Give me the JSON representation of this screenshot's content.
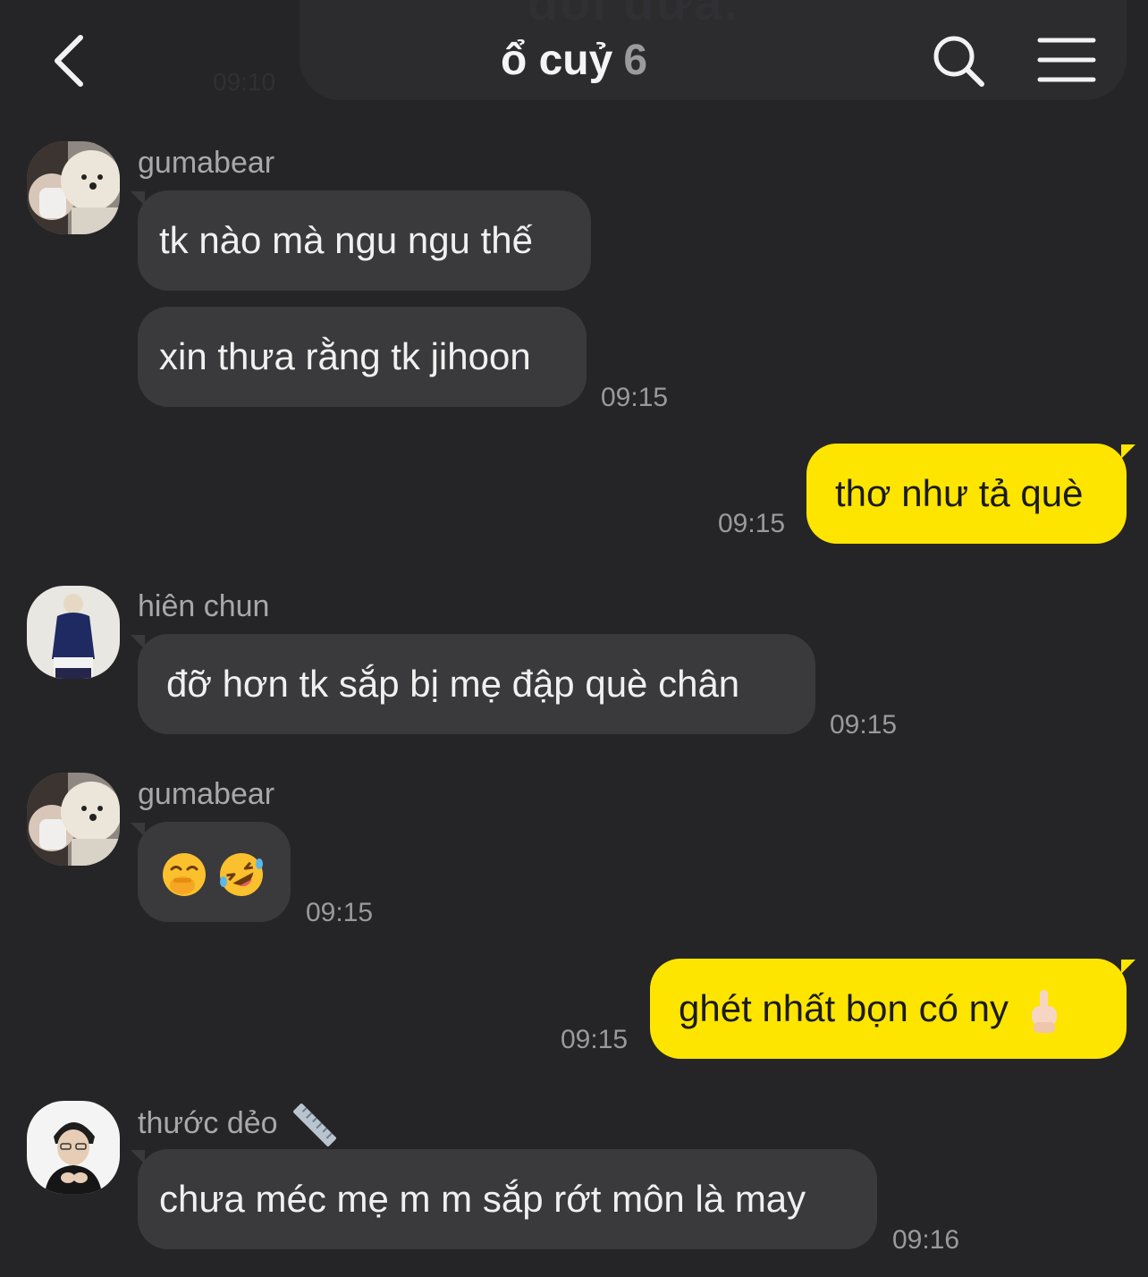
{
  "header": {
    "title": "ổ cuỷ",
    "member_count": "6",
    "back_icon": "chevron-left-icon",
    "search_icon": "search-icon",
    "menu_icon": "hamburger-menu-icon"
  },
  "partial_previous_message": {
    "text": "đổi dữa.",
    "time": "09:10"
  },
  "messages": [
    {
      "sender": "gumabear",
      "text": "tk nào mà ngu ngu thế"
    },
    {
      "text": "xin thưa rằng tk jihoon",
      "time": "09:15"
    },
    {
      "text": "thơ như tả què",
      "time": "09:15"
    },
    {
      "sender": "hiên chun",
      "text": "đỡ hơn tk sắp bị mẹ đập què chân",
      "time": "09:15"
    },
    {
      "sender": "gumabear",
      "emojis": [
        "face-with-hand-over-mouth-emoji",
        "rolling-on-floor-laughing-emoji"
      ],
      "time": "09:15"
    },
    {
      "text": "ghét nhất bọn có ny",
      "emoji": "middle-finger-emoji",
      "time": "09:15"
    },
    {
      "sender": "thước dẻo",
      "sender_emoji": "ruler-emoji",
      "text": "chưa méc mẹ m m sắp rớt môn là may",
      "time": "09:16"
    }
  ],
  "colors": {
    "background": "#252527",
    "incoming_bubble": "#3a3a3d",
    "outgoing_bubble": "#fee500",
    "timestamp": "#9a9a9a"
  }
}
